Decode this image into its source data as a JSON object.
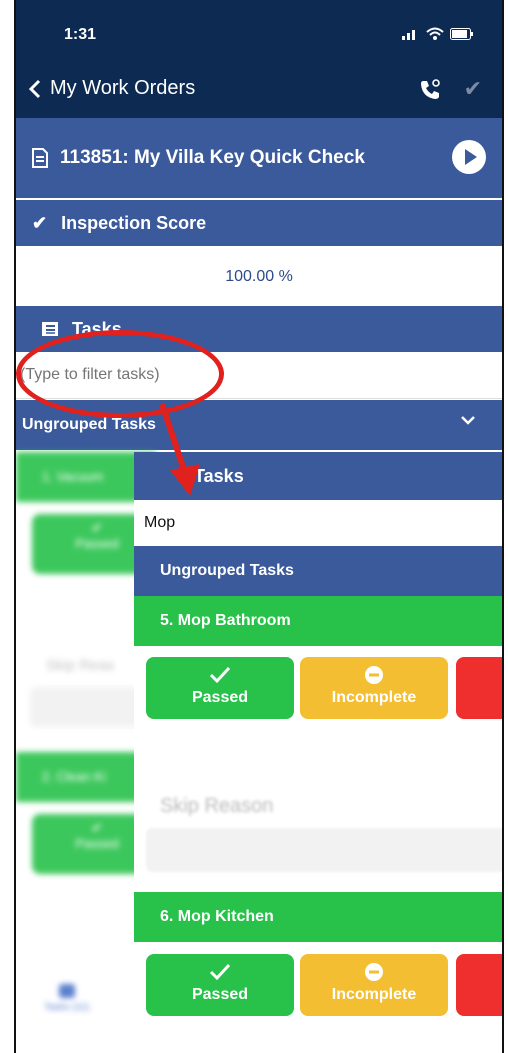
{
  "status": {
    "time": "1:31"
  },
  "nav": {
    "back_label": "My Work Orders"
  },
  "work_order": {
    "title": "113851: My Villa Key Quick Check"
  },
  "inspection": {
    "label": "Inspection Score",
    "value": "100.00 %"
  },
  "tasks_section": {
    "label": "Tasks",
    "filter_placeholder": "(Type to filter tasks)"
  },
  "group": {
    "label": "Ungrouped Tasks"
  },
  "background_list": {
    "task1": "1. Vacuum",
    "task2": "2. Clean Ki",
    "passed": "Passed",
    "skip": "Skip Reas",
    "tab": "Tasks (11)"
  },
  "overlay": {
    "tasks_label": "Tasks",
    "filter_value": "Mop",
    "group_label": "Ungrouped Tasks",
    "items": [
      {
        "label": "5. Mop Bathroom",
        "passed": "Passed",
        "incomplete": "Incomplete",
        "skip_reason": "Skip Reason"
      },
      {
        "label": "6. Mop Kitchen",
        "passed": "Passed",
        "incomplete": "Incomplete"
      }
    ]
  },
  "colors": {
    "nav_bg": "#0c2a52",
    "header_bg": "#3a5a9b",
    "pass": "#28c24b",
    "incomplete": "#f4be32",
    "fail": "#ef2e2e",
    "annotation": "#e0211d"
  }
}
